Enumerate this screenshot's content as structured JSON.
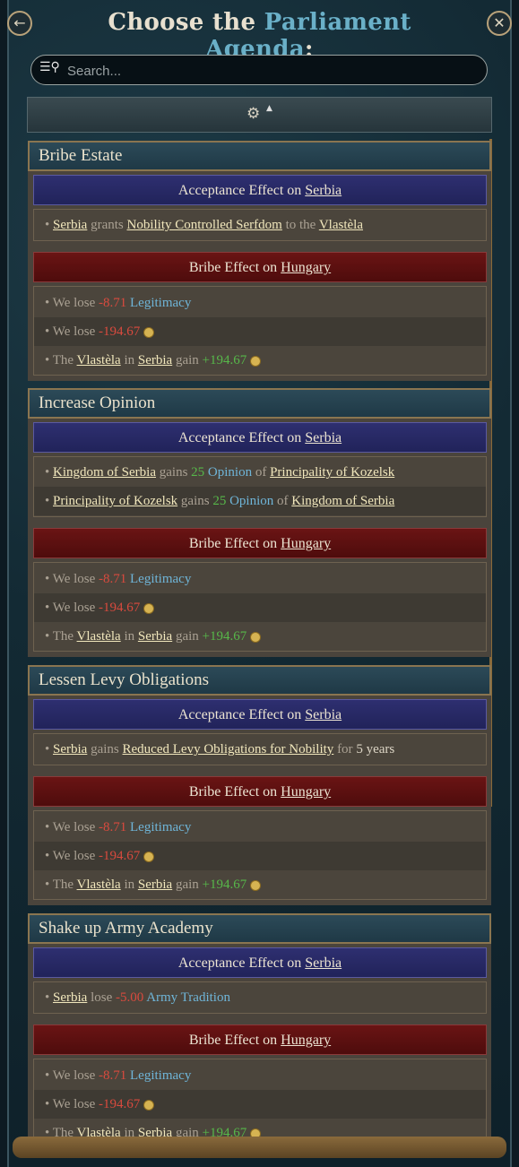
{
  "header": {
    "title_prefix": "Choose the ",
    "title_accent": "Parliament Agenda",
    "title_suffix": ":",
    "back_icon": "back-arrow-icon",
    "close_icon": "close-icon"
  },
  "search": {
    "placeholder": "Search..."
  },
  "sort": {
    "icon": "sort-icon"
  },
  "labels": {
    "accept": "Acceptance Effect on ",
    "bribe": "Bribe Effect on ",
    "accept_target": "Serbia",
    "bribe_target": "Hungary"
  },
  "common": {
    "we_lose": "We lose ",
    "legit_value": "-8.71",
    "legitimacy": "Legitimacy",
    "gold_value": "-194.67",
    "the": "The ",
    "vlastela": "Vlastèla",
    "in": " in ",
    "serbia": "Serbia",
    "gain": " gain ",
    "gain_value": "+194.67"
  },
  "cards": [
    {
      "title": "Bribe Estate",
      "accept_row": {
        "a": "Serbia",
        "b": " grants ",
        "c": "Nobility Controlled Serfdom",
        "d": " to the ",
        "e": "Vlastèla"
      }
    },
    {
      "title": "Increase Opinion",
      "rows": [
        {
          "a": "Kingdom of Serbia",
          "b": " gains ",
          "n": "25",
          "o": " Opinion",
          "p": " of ",
          "q": "Principality of Kozelsk"
        },
        {
          "a": "Principality of Kozelsk",
          "b": " gains ",
          "n": "25",
          "o": " Opinion",
          "p": " of ",
          "q": "Kingdom of Serbia"
        }
      ]
    },
    {
      "title": "Lessen Levy Obligations",
      "accept_row": {
        "a": "Serbia",
        "b": " gains ",
        "c": "Reduced Levy Obligations for Nobility",
        "d": " for ",
        "e": "5 years"
      }
    },
    {
      "title": "Shake up Army Academy",
      "accept_row": {
        "a": "Serbia",
        "b": " lose ",
        "c": "-5.00",
        "d": " Army Tradition"
      }
    }
  ]
}
